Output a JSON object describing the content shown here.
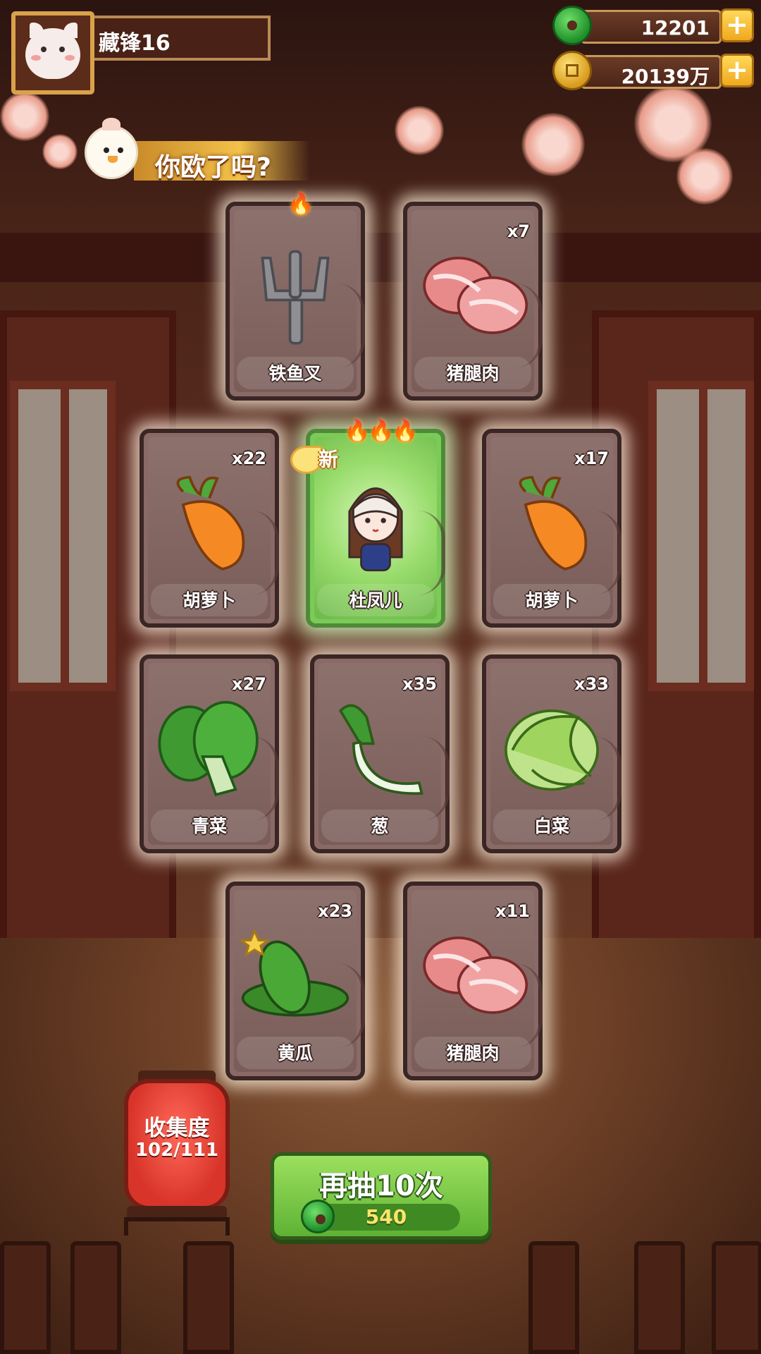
{
  "player": {
    "name": "藏锋16"
  },
  "currency": {
    "jade": {
      "value": "12201",
      "icon": "jade-coin-icon"
    },
    "gold": {
      "value": "20139万",
      "icon": "gold-coin-icon"
    }
  },
  "banner": {
    "text": "你欧了吗?"
  },
  "cards": [
    {
      "label": "铁鱼叉",
      "count": "",
      "flames": 1,
      "art": "fork"
    },
    {
      "label": "猪腿肉",
      "count": "x7",
      "flames": 0,
      "art": "meat"
    },
    {
      "label": "胡萝卜",
      "count": "x22",
      "flames": 0,
      "art": "carrot"
    },
    {
      "label": "杜凤儿",
      "count": "",
      "flames": 3,
      "art": "character",
      "badge": "新"
    },
    {
      "label": "胡萝卜",
      "count": "x17",
      "flames": 0,
      "art": "carrot"
    },
    {
      "label": "青菜",
      "count": "x27",
      "flames": 0,
      "art": "greens"
    },
    {
      "label": "葱",
      "count": "x35",
      "flames": 0,
      "art": "scallion"
    },
    {
      "label": "白菜",
      "count": "x33",
      "flames": 0,
      "art": "cabbage"
    },
    {
      "label": "黄瓜",
      "count": "x23",
      "flames": 0,
      "art": "cucumber"
    },
    {
      "label": "猪腿肉",
      "count": "x11",
      "flames": 0,
      "art": "meat"
    }
  ],
  "collection": {
    "title": "收集度",
    "value": "102/111"
  },
  "redraw": {
    "label": "再抽10次",
    "cost": "540",
    "cost_icon": "jade-coin-icon"
  },
  "colors": {
    "accent_green": "#6fc23e",
    "lantern_red": "#d9342a",
    "gold": "#f3c24a"
  }
}
